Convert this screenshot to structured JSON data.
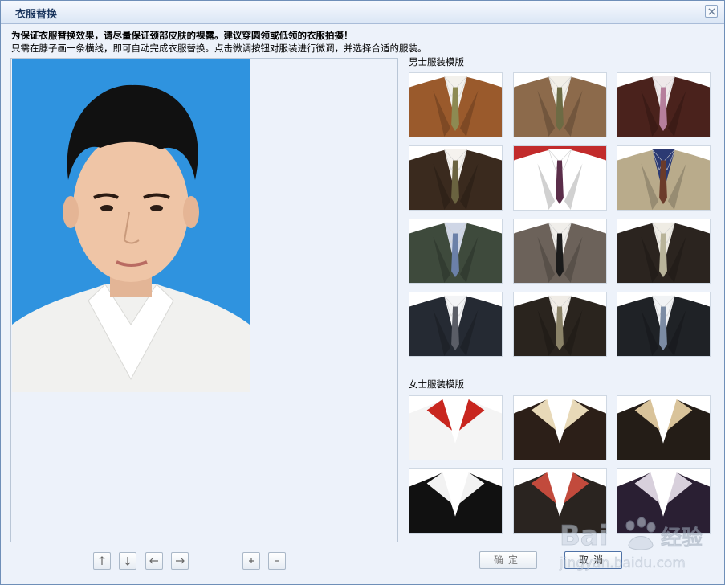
{
  "dialog": {
    "title": "衣服替换",
    "notice": "为保证衣服替换效果，请尽量保证颈部皮肤的裸露。建议穿圆领或低领的衣服拍摄！",
    "hint": "只需在脖子画一条横线，即可自动完成衣服替换。点击微调按钮对服装进行微调，并选择合适的服装。"
  },
  "sections": {
    "male_label": "男士服装模版",
    "female_label": "女士服装模版"
  },
  "male_templates": [
    {
      "jacket": "#9a5a2c",
      "shirt": "#f3f1ec",
      "tie": "#8d8a52"
    },
    {
      "jacket": "#8c6a4b",
      "shirt": "#f2efe8",
      "tie": "#6d6b44"
    },
    {
      "jacket": "#4a221c",
      "shirt": "#efe9ea",
      "tie": "#b67f9c"
    },
    {
      "jacket": "#3a2a1e",
      "shirt": "#f5f2ee",
      "tie": "#6a6340"
    },
    {
      "jacket": "#ffffff",
      "shirt": "#ffffff",
      "tie": "#5b2e4a",
      "bg": "#c22b2b"
    },
    {
      "jacket": "#b9ab8b",
      "shirt": "#2c3a73",
      "tie": "#6b3b2a"
    },
    {
      "jacket": "#3e4a3c",
      "shirt": "#cfd6e6",
      "tie": "#6b80a8"
    },
    {
      "jacket": "#6c625a",
      "shirt": "#f0eeea",
      "tie": "#1b1b1b"
    },
    {
      "jacket": "#2b241f",
      "shirt": "#efece4",
      "tie": "#b9b49a"
    },
    {
      "jacket": "#252a33",
      "shirt": "#f3f4f6",
      "tie": "#5a5d66"
    },
    {
      "jacket": "#2a241e",
      "shirt": "#f0ece6",
      "tie": "#8b8368"
    },
    {
      "jacket": "#1f2226",
      "shirt": "#f1f3f5",
      "tie": "#7c8ca4"
    }
  ],
  "female_templates": [
    {
      "jacket": "#f4f4f4",
      "shirt": "#ffffff",
      "collar": "#c8261f"
    },
    {
      "jacket": "#2c1f18",
      "shirt": "#ffffff",
      "collar": "#e8d9b8"
    },
    {
      "jacket": "#241d17",
      "shirt": "#ffffff",
      "collar": "#d9c39a"
    },
    {
      "jacket": "#111111",
      "shirt": "#ffffff",
      "collar": "#f2f2f2"
    },
    {
      "jacket": "#2a2420",
      "shirt": "#ffffff",
      "collar": "#c24a3c"
    },
    {
      "jacket": "#2a1f33",
      "shirt": "#ffffff",
      "collar": "#d8d0dc"
    }
  ],
  "controls": {
    "adjust_icons": [
      "arrow-up-icon",
      "arrow-down-icon",
      "arrow-left-icon",
      "arrow-right-icon",
      "plus-icon",
      "minus-icon"
    ],
    "confirm_label": "确定",
    "cancel_label": "取消"
  },
  "watermark": {
    "brand": "Bai",
    "brand_suffix": "经验",
    "url": "jingyan.baidu.com"
  }
}
